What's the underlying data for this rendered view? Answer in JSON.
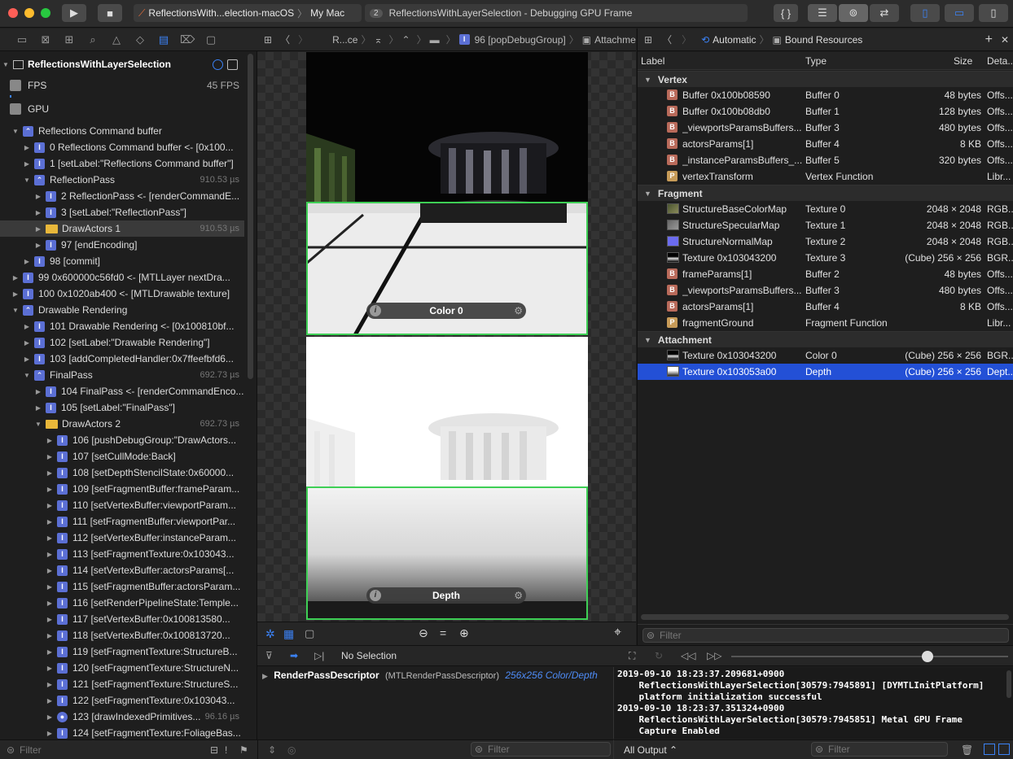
{
  "toolbar": {
    "scheme_target": "ReflectionsWith...election-macOS",
    "scheme_device": "My Mac",
    "activity_count": "2",
    "activity_text": "ReflectionsWithLayerSelection - Debugging GPU Frame"
  },
  "navigator": {
    "project": "ReflectionsWithLayerSelection",
    "fps_label": "FPS",
    "fps_value": "45 FPS",
    "gpu_label": "GPU",
    "items": [
      {
        "label": "Reflections Command buffer",
        "dur": ""
      },
      {
        "label": "0 Reflections Command buffer <- [0x100...",
        "dur": ""
      },
      {
        "label": "1 [setLabel:\"Reflections Command buffer\"]",
        "dur": ""
      },
      {
        "label": "ReflectionPass",
        "dur": "910.53 µs"
      },
      {
        "label": "2 ReflectionPass <- [renderCommandE...",
        "dur": ""
      },
      {
        "label": "3 [setLabel:\"ReflectionPass\"]",
        "dur": ""
      },
      {
        "label": "DrawActors 1",
        "dur": "910.53 µs"
      },
      {
        "label": "97 [endEncoding]",
        "dur": ""
      },
      {
        "label": "98 [commit]",
        "dur": ""
      },
      {
        "label": "99 0x600000c56fd0 <- [MTLLayer nextDra...",
        "dur": ""
      },
      {
        "label": "100 0x1020ab400 <- [MTLDrawable texture]",
        "dur": ""
      },
      {
        "label": "Drawable Rendering",
        "dur": ""
      },
      {
        "label": "101 Drawable Rendering <- [0x100810bf...",
        "dur": ""
      },
      {
        "label": "102 [setLabel:\"Drawable Rendering\"]",
        "dur": ""
      },
      {
        "label": "103 [addCompletedHandler:0x7ffeefbfd6...",
        "dur": ""
      },
      {
        "label": "FinalPass",
        "dur": "692.73 µs"
      },
      {
        "label": "104 FinalPass <- [renderCommandEnco...",
        "dur": ""
      },
      {
        "label": "105 [setLabel:\"FinalPass\"]",
        "dur": ""
      },
      {
        "label": "DrawActors 2",
        "dur": "692.73 µs"
      },
      {
        "label": "106 [pushDebugGroup:\"DrawActors...",
        "dur": ""
      },
      {
        "label": "107 [setCullMode:Back]",
        "dur": ""
      },
      {
        "label": "108 [setDepthStencilState:0x60000...",
        "dur": ""
      },
      {
        "label": "109 [setFragmentBuffer:frameParam...",
        "dur": ""
      },
      {
        "label": "110 [setVertexBuffer:viewportParam...",
        "dur": ""
      },
      {
        "label": "111 [setFragmentBuffer:viewportPar...",
        "dur": ""
      },
      {
        "label": "112 [setVertexBuffer:instanceParam...",
        "dur": ""
      },
      {
        "label": "113 [setFragmentTexture:0x103043...",
        "dur": ""
      },
      {
        "label": "114 [setVertexBuffer:actorsParams[...",
        "dur": ""
      },
      {
        "label": "115 [setFragmentBuffer:actorsParam...",
        "dur": ""
      },
      {
        "label": "116 [setRenderPipelineState:Temple...",
        "dur": ""
      },
      {
        "label": "117 [setVertexBuffer:0x100813580...",
        "dur": ""
      },
      {
        "label": "118 [setVertexBuffer:0x100813720...",
        "dur": ""
      },
      {
        "label": "119 [setFragmentTexture:StructureB...",
        "dur": ""
      },
      {
        "label": "120 [setFragmentTexture:StructureN...",
        "dur": ""
      },
      {
        "label": "121 [setFragmentTexture:StructureS...",
        "dur": ""
      },
      {
        "label": "122 [setFragmentTexture:0x103043...",
        "dur": ""
      },
      {
        "label": "123 [drawIndexedPrimitives...",
        "dur": "96.16 µs"
      },
      {
        "label": "124 [setFragmentTexture:FoliageBas...",
        "dur": ""
      }
    ],
    "filter_placeholder": "Filter"
  },
  "jumpbar": {
    "crumb1": "R...ce",
    "crumb2": "96 [popDebugGroup]",
    "crumb3": "Attachments"
  },
  "viewer": {
    "color_label": "Color 0",
    "depth_label": "Depth",
    "info_glyph": "i"
  },
  "resources": {
    "mode": "Automatic",
    "title": "Bound Resources",
    "columns": [
      "Label",
      "Type",
      "Size",
      "Deta..."
    ],
    "sections": [
      {
        "name": "Vertex",
        "rows": [
          {
            "icon": "B",
            "label": "Buffer 0x100b08590",
            "type": "Buffer 0",
            "size": "48 bytes",
            "detail": "Offs..."
          },
          {
            "icon": "B",
            "label": "Buffer 0x100b08db0",
            "type": "Buffer 1",
            "size": "128 bytes",
            "detail": "Offs..."
          },
          {
            "icon": "B",
            "label": "_viewportsParamsBuffers...",
            "type": "Buffer 3",
            "size": "480 bytes",
            "detail": "Offs..."
          },
          {
            "icon": "B",
            "label": "actorsParams[1]",
            "type": "Buffer 4",
            "size": "8 KB",
            "detail": "Offs..."
          },
          {
            "icon": "B",
            "label": "_instanceParamsBuffers_...",
            "type": "Buffer 5",
            "size": "320 bytes",
            "detail": "Offs..."
          },
          {
            "icon": "P",
            "label": "vertexTransform",
            "type": "Vertex Function",
            "size": "",
            "detail": "Libr..."
          }
        ]
      },
      {
        "name": "Fragment",
        "rows": [
          {
            "icon": "T1",
            "label": "StructureBaseColorMap",
            "type": "Texture 0",
            "size": "2048 × 2048",
            "detail": "RGB..."
          },
          {
            "icon": "T2",
            "label": "StructureSpecularMap",
            "type": "Texture 1",
            "size": "2048 × 2048",
            "detail": "RGB..."
          },
          {
            "icon": "T3",
            "label": "StructureNormalMap",
            "type": "Texture 2",
            "size": "2048 × 2048",
            "detail": "RGB..."
          },
          {
            "icon": "T4",
            "label": "Texture 0x103043200",
            "type": "Texture 3",
            "size": "(Cube) 256 × 256",
            "detail": "BGR..."
          },
          {
            "icon": "B",
            "label": "frameParams[1]",
            "type": "Buffer 2",
            "size": "48 bytes",
            "detail": "Offs..."
          },
          {
            "icon": "B",
            "label": "_viewportsParamsBuffers...",
            "type": "Buffer 3",
            "size": "480 bytes",
            "detail": "Offs..."
          },
          {
            "icon": "B",
            "label": "actorsParams[1]",
            "type": "Buffer 4",
            "size": "8 KB",
            "detail": "Offs..."
          },
          {
            "icon": "P",
            "label": "fragmentGround",
            "type": "Fragment Function",
            "size": "",
            "detail": "Libr..."
          }
        ]
      },
      {
        "name": "Attachment",
        "rows": [
          {
            "icon": "T4",
            "label": "Texture 0x103043200",
            "type": "Color 0",
            "size": "(Cube) 256 × 256",
            "detail": "BGR..."
          },
          {
            "icon": "T5",
            "label": "Texture 0x103053a00",
            "type": "Depth",
            "size": "(Cube) 256 × 256",
            "detail": "Dept..."
          }
        ]
      }
    ],
    "filter_placeholder": "Filter"
  },
  "debug": {
    "selection": "No Selection",
    "variable_name": "RenderPassDescriptor",
    "variable_type": "(MTLRenderPassDescriptor)",
    "variable_value": "256x256 Color/Depth",
    "slider_value": 0.71
  },
  "console": {
    "text": "2019-09-10 18:23:37.209681+0900\n    ReflectionsWithLayerSelection[30579:7945891] [DYMTLInitPlatform]\n    platform initialization successful\n2019-09-10 18:23:37.351324+0900\n    ReflectionsWithLayerSelection[30579:7945851] Metal GPU Frame\n    Capture Enabled",
    "output_selector": "All Output",
    "filter_placeholder": "Filter"
  }
}
